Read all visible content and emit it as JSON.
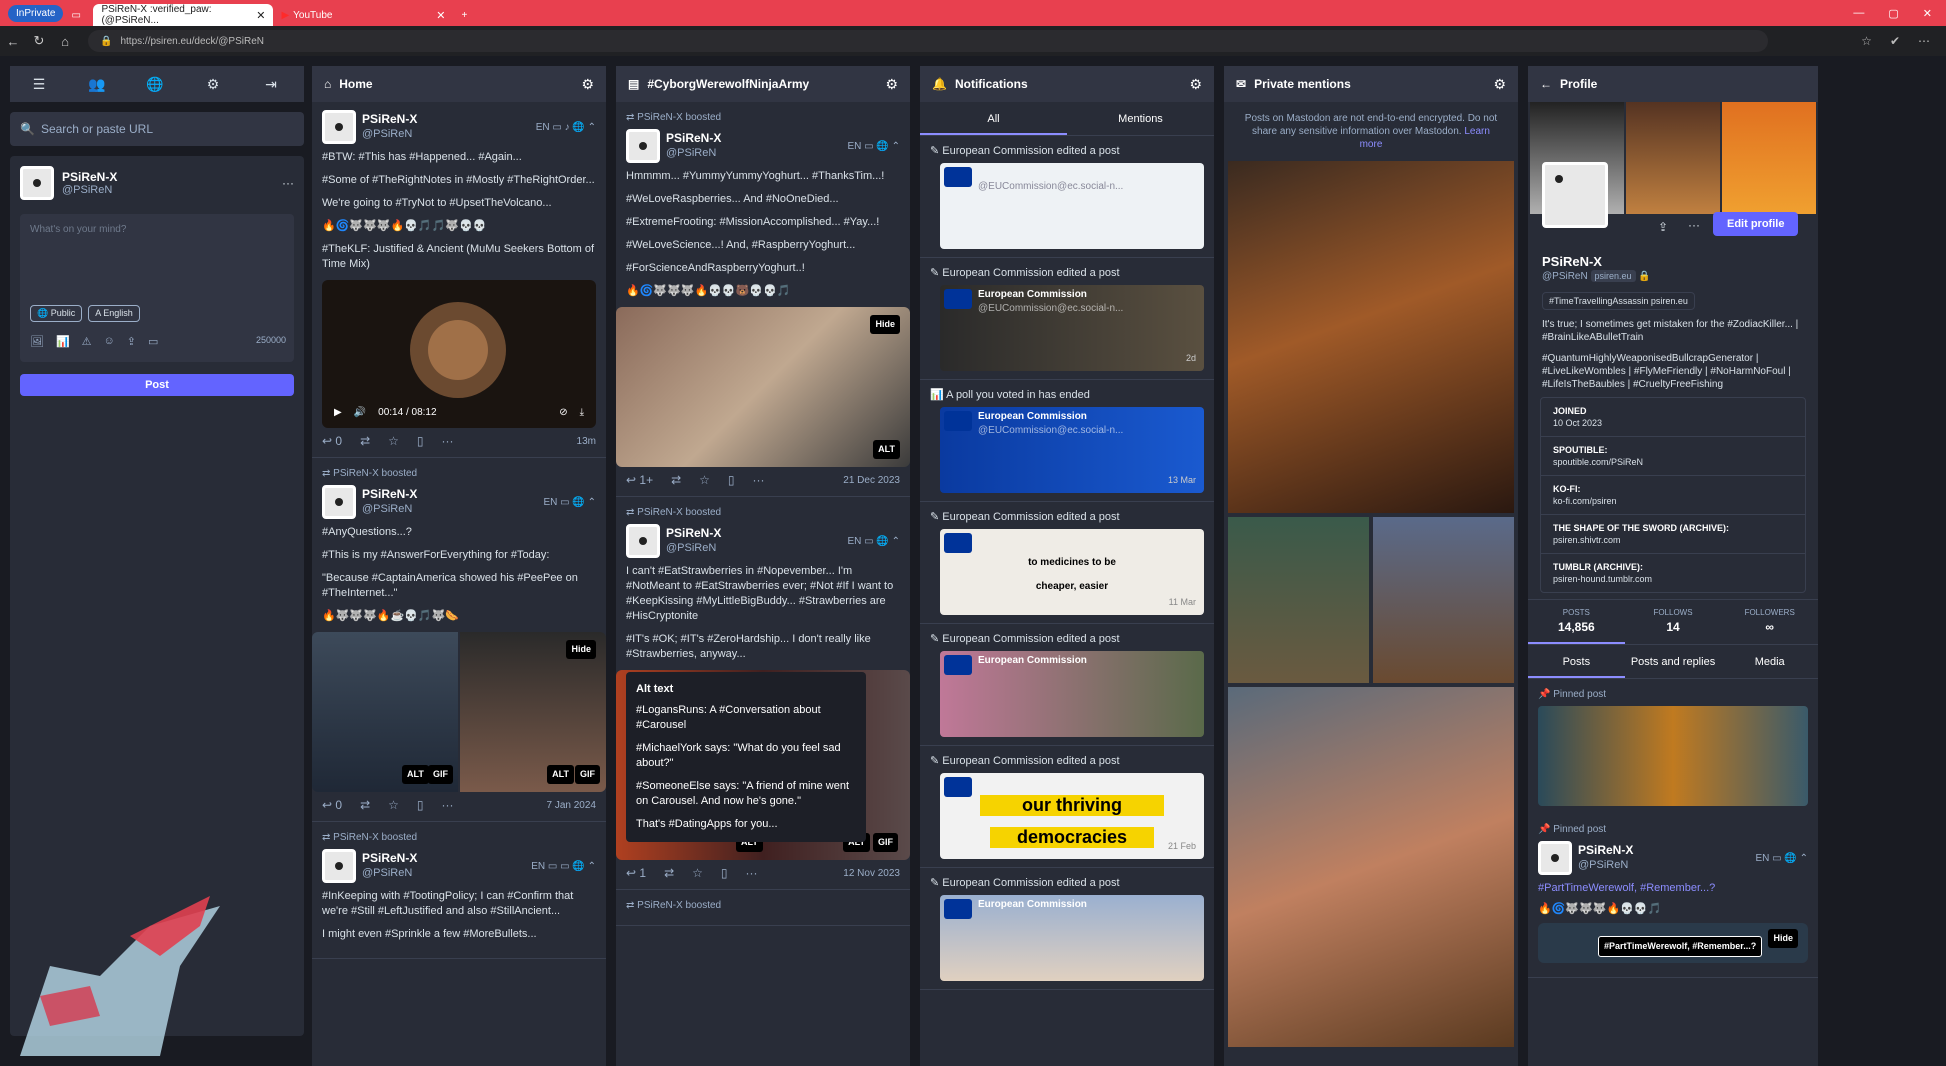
{
  "browser": {
    "inprivate": "InPrivate",
    "tab1": "PSiReN-X :verified_paw: (@PSiReN...",
    "tab2": "YouTube",
    "url": "https://psiren.eu/deck/@PSiReN"
  },
  "nav": {
    "search_placeholder": "Search or paste URL",
    "me_name": "PSiReN-X",
    "me_handle": "@PSiReN",
    "compose_placeholder": "What's on your mind?",
    "public": "Public",
    "english": "English",
    "char_count": "250000",
    "post": "Post"
  },
  "home": {
    "title": "Home",
    "p1": {
      "name": "PSiReN-X",
      "handle": "@PSiReN",
      "l1": "#BTW: #This has #Happened... #Again...",
      "l2": "#Some of #TheRightNotes in #Mostly #TheRightOrder...",
      "l3": "We're going to #TryNot to #UpsetTheVolcano...",
      "l4": "#TheKLF: Justified & Ancient (MuMu Seekers Bottom of Time Mix)",
      "time": "00:14 / 08:12",
      "ts": "13m"
    },
    "b2": "PSiReN-X boosted",
    "p2": {
      "name": "PSiReN-X",
      "handle": "@PSiReN",
      "l1": "#AnyQuestions...?",
      "l2": "#This is my #AnswerForEverything for #Today:",
      "l3": "\"Because #CaptainAmerica showed his #PeePee on #TheInternet...\"",
      "ts": "7 Jan 2024"
    },
    "b3": "PSiReN-X boosted",
    "p3": {
      "name": "PSiReN-X",
      "handle": "@PSiReN",
      "l1": "#InKeeping with #TootingPolicy; I can #Confirm that we're #Still #LeftJustified and also #StillAncient...",
      "l2": "I might even #Sprinkle a few #MoreBullets..."
    }
  },
  "hashtag": {
    "title": "#CyborgWerewolfNinjaArmy",
    "b1": "PSiReN-X boosted",
    "p1": {
      "name": "PSiReN-X",
      "handle": "@PSiReN",
      "l1": "Hmmmm... #YummyYummyYoghurt... #ThanksTim...!",
      "l2": "#WeLoveRaspberries... And #NoOneDied...",
      "l3": "#ExtremeFrooting: #MissionAccomplished... #Yay...!",
      "l4": "#WeLoveScience...! And, #RaspberryYoghurt...",
      "l5": "#ForScienceAndRaspberryYoghurt..!",
      "ts": "21 Dec 2023"
    },
    "b2": "PSiReN-X boosted",
    "p2": {
      "name": "PSiReN-X",
      "handle": "@PSiReN",
      "l1": "I can't #EatStrawberries in #Nopevember... I'm #NotMeant to #EatStrawberries ever; #Not #If I want to #KeepKissing #MyLittleBigBuddy... #Strawberries are #HisCryptonite",
      "l2": "#IT's #OK; #IT's #ZeroHardship... I don't really like #Strawberries, anyway...",
      "ts": "12 Nov 2023"
    },
    "alt": {
      "title": "Alt text",
      "a1": "#LogansRuns: A #Conversation about #Carousel",
      "a2": "#MichaelYork says: \"What do you feel sad about?\"",
      "a3": "#SomeoneElse says: \"A friend of mine went on Carousel. And now he's gone.\"",
      "a4": "That's #DatingApps for you..."
    },
    "b3": "PSiReN-X boosted"
  },
  "notifications": {
    "title": "Notifications",
    "tab_all": "All",
    "tab_mentions": "Mentions",
    "n1": "European Commission edited a post",
    "n2": "European Commission edited a post",
    "n3": "A poll you voted in has ended",
    "n4": "European Commission edited a post",
    "n5": "European Commission edited a post",
    "n6": "European Commission edited a post",
    "n7": "European Commission edited a post",
    "who": "European Commission",
    "handle": "@EUCommission@ec.social-n...",
    "d2": "2d",
    "d3": "13 Mar",
    "d4": "11 Mar",
    "d6": "21 Feb",
    "big1": "our thriving",
    "big2": "democracies",
    "mid": "to medicines to be",
    "mid2": "cheaper, easier"
  },
  "private": {
    "title": "Private mentions",
    "notice": "Posts on Mastodon are not end-to-end encrypted. Do not share any sensitive information over Mastodon.",
    "learn": "Learn more"
  },
  "profile": {
    "title": "Profile",
    "edit": "Edit profile",
    "name": "PSiReN-X",
    "handle": "@PSiReN",
    "domain": "psiren.eu",
    "tag": "#TimeTravellingAssassin psiren.eu",
    "bio1": "It's true; I sometimes get mistaken for the #ZodiacKiller... | #BrainLikeABulletTrain",
    "bio2": "#QuantumHighlyWeaponisedBullcrapGenerator | #LiveLikeWombles | #FlyMeFriendly | #NoHarmNoFoul | #LifeIsTheBaubles | #CrueltyFreeFishing",
    "joined_k": "JOINED",
    "joined_v": "10 Oct 2023",
    "f1k": "SPOUTIBLE:",
    "f1v": "spoutible.com/PSiReN",
    "f2k": "KO-FI:",
    "f2v": "ko-fi.com/psiren",
    "f3k": "THE SHAPE OF THE SWORD (ARCHIVE):",
    "f3v": "psiren.shivtr.com",
    "f4k": "TUMBLR (ARCHIVE):",
    "f4v": "psiren-hound.tumblr.com",
    "posts_k": "POSTS",
    "posts_v": "14,856",
    "follows_k": "FOLLOWS",
    "follows_v": "14",
    "followers_k": "FOLLOWERS",
    "followers_v": "∞",
    "t1": "Posts",
    "t2": "Posts and replies",
    "t3": "Media",
    "pinned": "Pinned post",
    "pinned2": "Pinned post",
    "pp_name": "PSiReN-X",
    "pp_handle": "@PSiReN",
    "pp_text": "#PartTimeWerewolf, #Remember...?",
    "pp_alt": "#PartTimeWerewolf, #Remember...?"
  }
}
